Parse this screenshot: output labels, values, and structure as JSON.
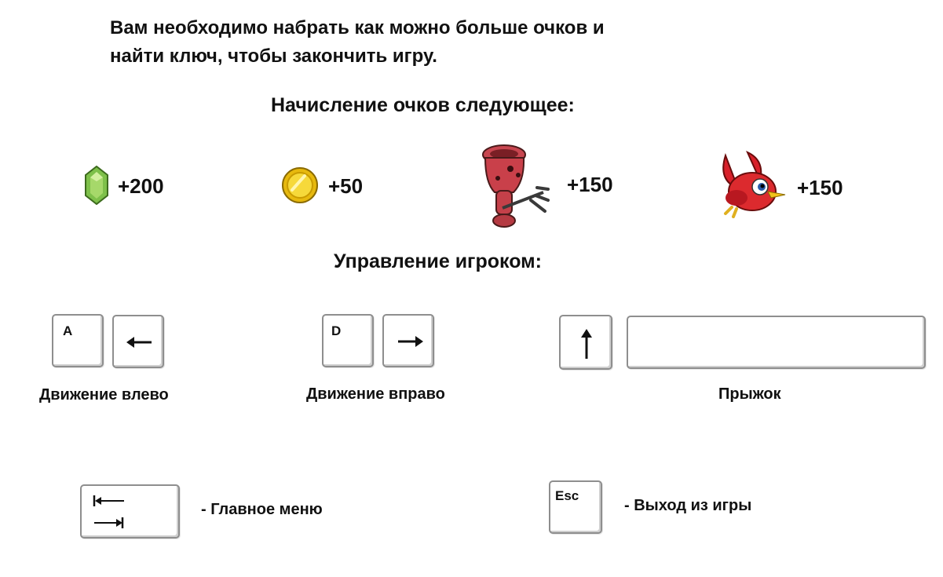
{
  "intro": {
    "line1": "Вам необходимо набрать как можно больше очков и",
    "line2": "найти ключ, чтобы закончить игру."
  },
  "scoring": {
    "heading": "Начисление очков следующее:",
    "items": [
      {
        "icon": "green-gem-icon",
        "points": "+200"
      },
      {
        "icon": "gold-coin-icon",
        "points": "+50"
      },
      {
        "icon": "red-trident-monster-icon",
        "points": "+150"
      },
      {
        "icon": "red-bird-icon",
        "points": "+150"
      }
    ]
  },
  "controls": {
    "heading": "Управление игроком:",
    "move_left": {
      "key1": "A",
      "key2_icon": "arrow-left-icon",
      "label": "Движение влево"
    },
    "move_right": {
      "key1": "D",
      "key2_icon": "arrow-right-icon",
      "label": "Движение вправо"
    },
    "jump": {
      "key1_icon": "arrow-up-icon",
      "key2_icon": "spacebar-key",
      "label": "Прыжок"
    },
    "menu": {
      "key_icon": "tab-key-icon",
      "label": "- Главное меню"
    },
    "exit": {
      "key": "Esc",
      "label": "- Выход из игры"
    }
  },
  "colors": {
    "text": "#111111",
    "key_border": "#8e8e8e",
    "gem": "#6fb83f",
    "coin": "#f2cf1a",
    "monster": "#c9404a",
    "bird": "#d8202a"
  }
}
